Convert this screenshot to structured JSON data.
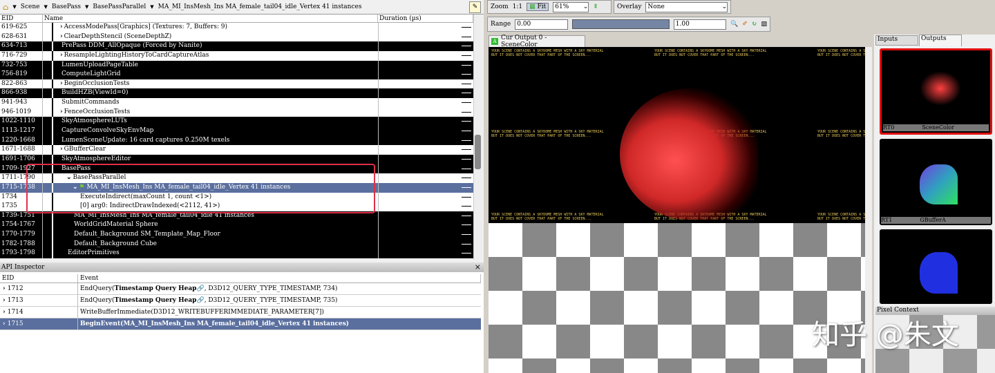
{
  "breadcrumb": [
    "Scene",
    "BasePass",
    "BasePassParallel",
    "MA_MI_InsMesh_Ins MA_female_tail04_idle_Vertex 41 instances"
  ],
  "event_browser": {
    "columns": [
      "EID",
      "Name",
      "Duration (µs)"
    ],
    "rows": [
      {
        "eid": "619-625",
        "name": "AccessModePass[Graphics] (Textures: 7, Buffers: 9)",
        "style": "w",
        "indent": 0,
        "expander": "›"
      },
      {
        "eid": "628-631",
        "name": "ClearDepthStencil (SceneDepthZ)",
        "style": "w",
        "indent": 0,
        "expander": "›"
      },
      {
        "eid": "634-713",
        "name": "PrePass DDM_AllOpaque (Forced by Nanite)",
        "style": "b",
        "indent": 0,
        "expander": ""
      },
      {
        "eid": "716-729",
        "name": "ResampleLightingHistoryToCardCaptureAtlas",
        "style": "w",
        "indent": 0,
        "expander": "›"
      },
      {
        "eid": "732-753",
        "name": "LumenUploadPageTable",
        "style": "b",
        "indent": 0,
        "expander": ""
      },
      {
        "eid": "756-819",
        "name": "ComputeLightGrid",
        "style": "b",
        "indent": 0,
        "expander": ""
      },
      {
        "eid": "822-863",
        "name": "BeginOcclusionTests",
        "style": "w",
        "indent": 0,
        "expander": "›"
      },
      {
        "eid": "866-938",
        "name": "BuildHZB(ViewId=0)",
        "style": "b",
        "indent": 0,
        "expander": ""
      },
      {
        "eid": "941-943",
        "name": "SubmitCommands",
        "style": "w",
        "indent": 0,
        "expander": ""
      },
      {
        "eid": "946-1019",
        "name": "FenceOcclusionTests",
        "style": "w",
        "indent": 0,
        "expander": "›"
      },
      {
        "eid": "1022-1110",
        "name": "SkyAtmosphereLUTs",
        "style": "b",
        "indent": 0,
        "expander": ""
      },
      {
        "eid": "1113-1217",
        "name": "CaptureConvolveSkyEnvMap",
        "style": "b",
        "indent": 0,
        "expander": ""
      },
      {
        "eid": "1220-1668",
        "name": "LumenSceneUpdate: 16 card captures 0.250M texels",
        "style": "b",
        "indent": 0,
        "expander": ""
      },
      {
        "eid": "1671-1688",
        "name": "GBufferClear",
        "style": "w",
        "indent": 0,
        "expander": "›"
      },
      {
        "eid": "1691-1706",
        "name": "SkyAtmosphereEditor",
        "style": "b",
        "indent": 0,
        "expander": ""
      },
      {
        "eid": "1709-1927",
        "name": "BasePass",
        "style": "b",
        "indent": 0,
        "expander": ""
      },
      {
        "eid": "1711-1790",
        "name": "BasePassParallel",
        "style": "w",
        "indent": 1,
        "expander": "⌄"
      },
      {
        "eid": "1715-1738",
        "name": "MA_MI_InsMesh_Ins MA_female_tail04_idle_Vertex 41 instances",
        "style": "s",
        "indent": 2,
        "expander": "⌄"
      },
      {
        "eid": "1734",
        "name": "ExecuteIndirect(maxCount 1, count <1>)",
        "style": "w",
        "indent": 3,
        "expander": ""
      },
      {
        "eid": "1735",
        "name": "[0] arg0: IndirectDrawIndexed(<2112, 41>)",
        "style": "w",
        "indent": 3,
        "expander": ""
      },
      {
        "eid": "1739-1751",
        "name": "MA_MI_InsMesh_Ins MA_female_tail04_idle 41 instances",
        "style": "b",
        "indent": 2,
        "expander": ""
      },
      {
        "eid": "1754-1767",
        "name": "WorldGridMaterial Sphere",
        "style": "b",
        "indent": 2,
        "expander": ""
      },
      {
        "eid": "1770-1779",
        "name": "Default_Background SM_Template_Map_Floor",
        "style": "b",
        "indent": 2,
        "expander": ""
      },
      {
        "eid": "1782-1788",
        "name": "Default_Background Cube",
        "style": "b",
        "indent": 2,
        "expander": ""
      },
      {
        "eid": "1793-1798",
        "name": "EditorPrimitives",
        "style": "b",
        "indent": 1,
        "expander": ""
      }
    ]
  },
  "api_inspector": {
    "title": "API Inspector",
    "close": "×",
    "columns": [
      "EID",
      "Event"
    ],
    "rows": [
      {
        "eid": "1712",
        "pre": "EndQuery(",
        "bold": "Timestamp Query Heap",
        "post": "🔗,  D3D12_QUERY_TYPE_TIMESTAMP,   734)"
      },
      {
        "eid": "1713",
        "pre": "EndQuery(",
        "bold": "Timestamp Query Heap",
        "post": "🔗,  D3D12_QUERY_TYPE_TIMESTAMP,   735)"
      },
      {
        "eid": "1714",
        "pre": "WriteBufferImmediate(D3D12_WRITEBUFFERIMMEDIATE_PARAMETER[7])",
        "bold": "",
        "post": ""
      },
      {
        "eid": "1715",
        "pre": "",
        "bold": "BeginEvent(MA_MI_InsMesh_Ins MA_female_tail04_idle_Vertex 41 instances)",
        "post": ""
      }
    ]
  },
  "toolbar": {
    "zoom_label": "Zoom",
    "one_to_one": "1:1",
    "fit": "Fit",
    "zoom_value": "61%",
    "overlay_label": "Overlay",
    "overlay_value": "None",
    "range_label": "Range",
    "range_min": "0.00",
    "range_max": "1.00"
  },
  "viewer": {
    "tab": "Cur Output 0 - SceneColor",
    "warning_line1": "YOUR SCENE CONTAINS A SKYDOME MESH WITH A SKY MATERIAL",
    "warning_line2": "BUT IT DOES NOT COVER THAT PART OF THE SCREEN..."
  },
  "side": {
    "tabs": [
      "Inputs",
      "Outputs"
    ],
    "thumbs": [
      {
        "slot": "RT0",
        "name": "SceneColor"
      },
      {
        "slot": "RT1",
        "name": "GBufferA"
      }
    ],
    "pixel_context": "Pixel Context"
  },
  "watermark": "知乎 @朱文"
}
